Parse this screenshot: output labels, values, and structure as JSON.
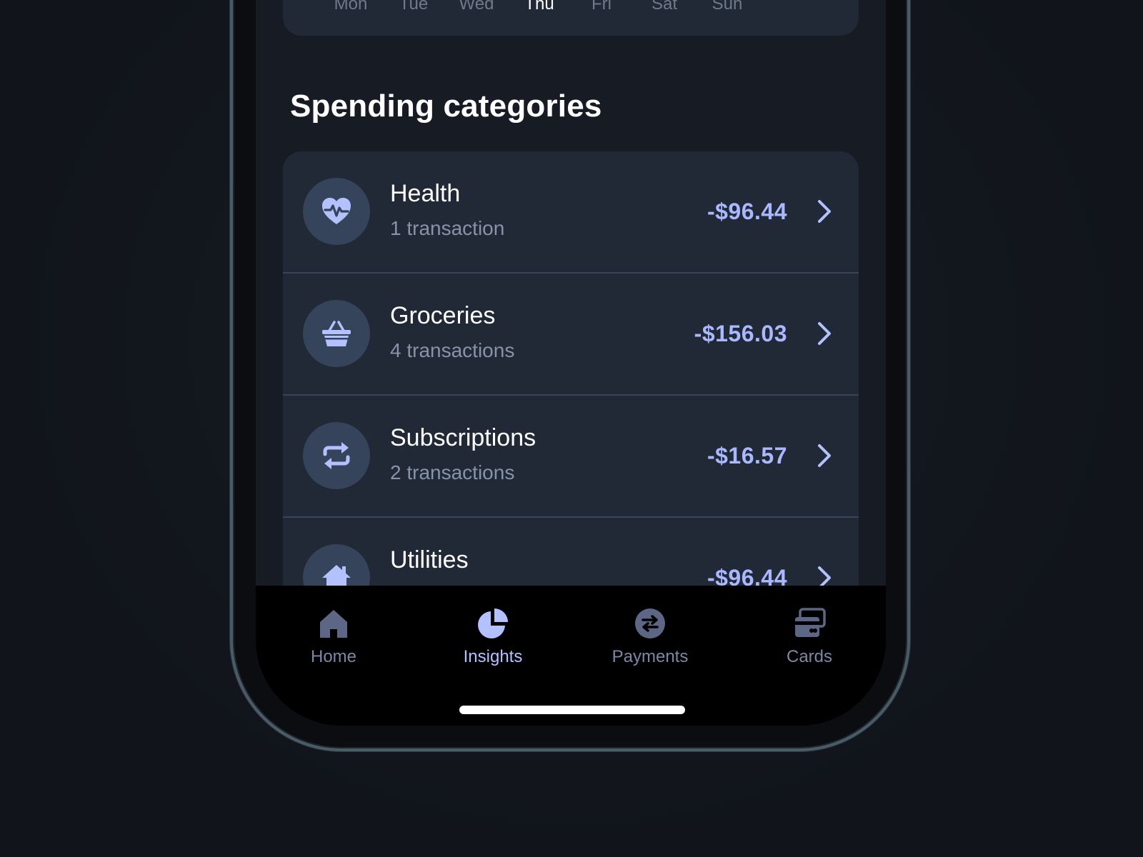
{
  "chart": {
    "days": [
      {
        "label": "Mon",
        "active": false
      },
      {
        "label": "Tue",
        "active": false
      },
      {
        "label": "Wed",
        "active": false
      },
      {
        "label": "Thu",
        "active": true
      },
      {
        "label": "Fri",
        "active": false
      },
      {
        "label": "Sat",
        "active": false
      },
      {
        "label": "Sun",
        "active": false
      }
    ]
  },
  "section": {
    "title": "Spending categories"
  },
  "categories": [
    {
      "name": "Health",
      "count": "1 transaction",
      "amount": "-$96.44",
      "icon": "heart-pulse-icon"
    },
    {
      "name": "Groceries",
      "count": "4 transactions",
      "amount": "-$156.03",
      "icon": "basket-icon"
    },
    {
      "name": "Subscriptions",
      "count": "2 transactions",
      "amount": "-$16.57",
      "icon": "repeat-icon"
    },
    {
      "name": "Utilities",
      "count": "",
      "amount": "-$96.44",
      "icon": "house-icon"
    }
  ],
  "tabbar": {
    "tabs": [
      {
        "label": "Home",
        "icon": "home-icon",
        "active": false
      },
      {
        "label": "Insights",
        "icon": "pie-chart-icon",
        "active": true
      },
      {
        "label": "Payments",
        "icon": "transfer-icon",
        "active": false
      },
      {
        "label": "Cards",
        "icon": "cards-icon",
        "active": false
      }
    ]
  },
  "colors": {
    "accent": "#a9b8ff",
    "active_tab": "#b4c1ff",
    "inactive_tab": "#5d6685",
    "card_bg": "#212936",
    "icon_circle": "#35445a"
  }
}
